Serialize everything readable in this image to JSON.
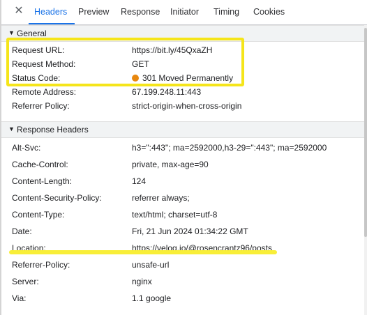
{
  "tabs": [
    {
      "label": "Headers",
      "active": true
    },
    {
      "label": "Preview",
      "active": false
    },
    {
      "label": "Response",
      "active": false
    },
    {
      "label": "Initiator",
      "active": false
    },
    {
      "label": "Timing",
      "active": false
    },
    {
      "label": "Cookies",
      "active": false
    }
  ],
  "general": {
    "title": "General",
    "rows": [
      {
        "name": "Request URL:",
        "value": "https://bit.ly/45QxaZH"
      },
      {
        "name": "Request Method:",
        "value": "GET"
      },
      {
        "name": "Status Code:",
        "value": "301 Moved Permanently"
      },
      {
        "name": "Remote Address:",
        "value": "67.199.248.11:443"
      },
      {
        "name": "Referrer Policy:",
        "value": "strict-origin-when-cross-origin"
      }
    ]
  },
  "response_headers": {
    "title": "Response Headers",
    "rows": [
      {
        "name": "Alt-Svc:",
        "value": "h3=\":443\"; ma=2592000,h3-29=\":443\"; ma=2592000"
      },
      {
        "name": "Cache-Control:",
        "value": "private, max-age=90"
      },
      {
        "name": "Content-Length:",
        "value": "124"
      },
      {
        "name": "Content-Security-Policy:",
        "value": "referrer always;"
      },
      {
        "name": "Content-Type:",
        "value": "text/html; charset=utf-8"
      },
      {
        "name": "Date:",
        "value": "Fri, 21 Jun 2024 01:34:22 GMT"
      },
      {
        "name": "Location:",
        "value": "https://velog.io/@rosencrantz96/posts"
      },
      {
        "name": "Referrer-Policy:",
        "value": "unsafe-url"
      },
      {
        "name": "Server:",
        "value": "nginx"
      },
      {
        "name": "Via:",
        "value": "1.1 google"
      }
    ]
  },
  "colors": {
    "accent": "#1a73e8",
    "status_dot": "#e8880f",
    "highlight": "#f5e51a"
  },
  "icons": {
    "close": "close-icon",
    "expand": "triangle-down-icon",
    "status": "status-dot-icon"
  }
}
